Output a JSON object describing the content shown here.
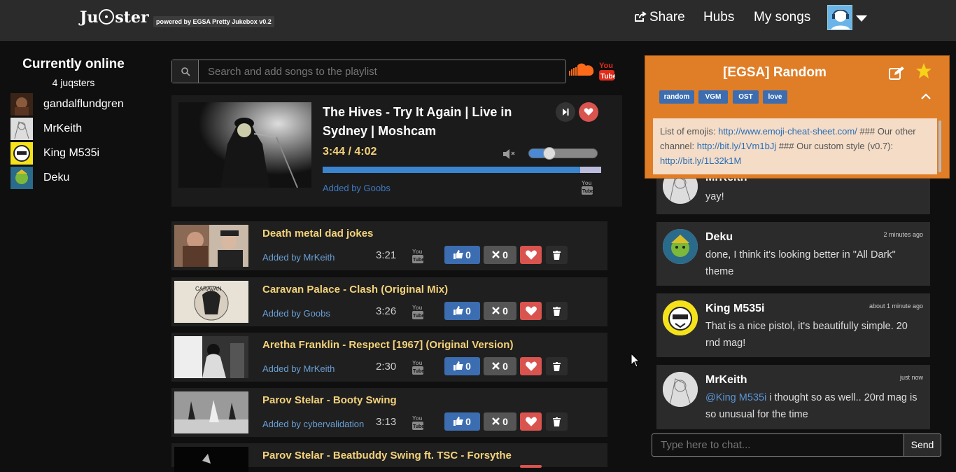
{
  "header": {
    "logo_text_left": "Ju",
    "logo_text_right": "ster",
    "powered_by": "powered by EGSA Pretty Jukebox v0.2",
    "nav": {
      "share": "Share",
      "hubs": "Hubs",
      "my_songs": "My songs"
    },
    "icons": [
      "share-icon",
      "user-avatar",
      "caret-down-icon"
    ]
  },
  "online": {
    "title": "Currently online",
    "count": "4 juqsters",
    "users": [
      {
        "name": "gandalflundgren"
      },
      {
        "name": "MrKeith"
      },
      {
        "name": "King M535i"
      },
      {
        "name": "Deku"
      }
    ]
  },
  "search": {
    "placeholder": "Search and add songs to the playlist",
    "icon": "search-icon",
    "sources": [
      "soundcloud-icon",
      "youtube-icon"
    ]
  },
  "now_playing": {
    "title": "The Hives - Try It Again | Live in Sydney | Moshcam",
    "time": "3:44 / 4:02",
    "progress": 0.925,
    "volume": 0.3,
    "added_by_label": "Added by Goobs",
    "icons": [
      "skip-icon",
      "heart-icon",
      "volume-icon",
      "youtube-icon"
    ]
  },
  "playlist": [
    {
      "title": "Death metal dad jokes",
      "added_by_label": "Added by ",
      "added_by": "MrKeith",
      "duration": "3:21",
      "up": "0",
      "down": "0"
    },
    {
      "title": "Caravan Palace - Clash (Original Mix)",
      "added_by_label": "Added by ",
      "added_by": "Goobs",
      "duration": "3:26",
      "up": "0",
      "down": "0"
    },
    {
      "title": "Aretha Franklin - Respect [1967] (Original Version)",
      "added_by_label": "Added by ",
      "added_by": "MrKeith",
      "duration": "2:30",
      "up": "0",
      "down": "0"
    },
    {
      "title": "Parov Stelar - Booty Swing",
      "added_by_label": "Added by ",
      "added_by": "cybervalidation",
      "duration": "3:13",
      "up": "0",
      "down": "0"
    },
    {
      "title": "Parov Stelar - Beatbuddy Swing ft. TSC - Forsythe",
      "added_by_label": "",
      "added_by": "",
      "duration": "",
      "up": "",
      "down": ""
    }
  ],
  "hub": {
    "title": "[EGSA] Random",
    "tags": [
      "random",
      "VGM",
      "OST",
      "love"
    ],
    "desc_1": "List of emojis: ",
    "link_1": "http://www.emoji-cheat-sheet.com/",
    "desc_2": " ### Our other channel: ",
    "link_2": "http://bit.ly/1Vm1bJj",
    "desc_3": " ### Our custom style (v0.7): ",
    "link_3": "http://bit.ly/1L32k1M",
    "colors": {
      "panel": "#e07d27",
      "desc_bg": "#f4dcc6",
      "tag": "#3b6db0"
    }
  },
  "chat": {
    "messages": [
      {
        "author": "MrKeith",
        "time": "",
        "text": "yay!"
      },
      {
        "author": "Deku",
        "time": "2 minutes ago",
        "text": "done, I think it's looking better in \"All Dark\" theme"
      },
      {
        "author": "King M535i",
        "time": "about 1 minute ago",
        "text": "That is a nice pistol, it's beautifully simple. 20 rnd mag!"
      },
      {
        "author": "MrKeith",
        "time": "just now",
        "mention": "@King M535i",
        "text": " i thought so as well.. 20rd mag is so unusual for the time"
      }
    ],
    "input_placeholder": "Type here to chat...",
    "send_label": "Send"
  }
}
